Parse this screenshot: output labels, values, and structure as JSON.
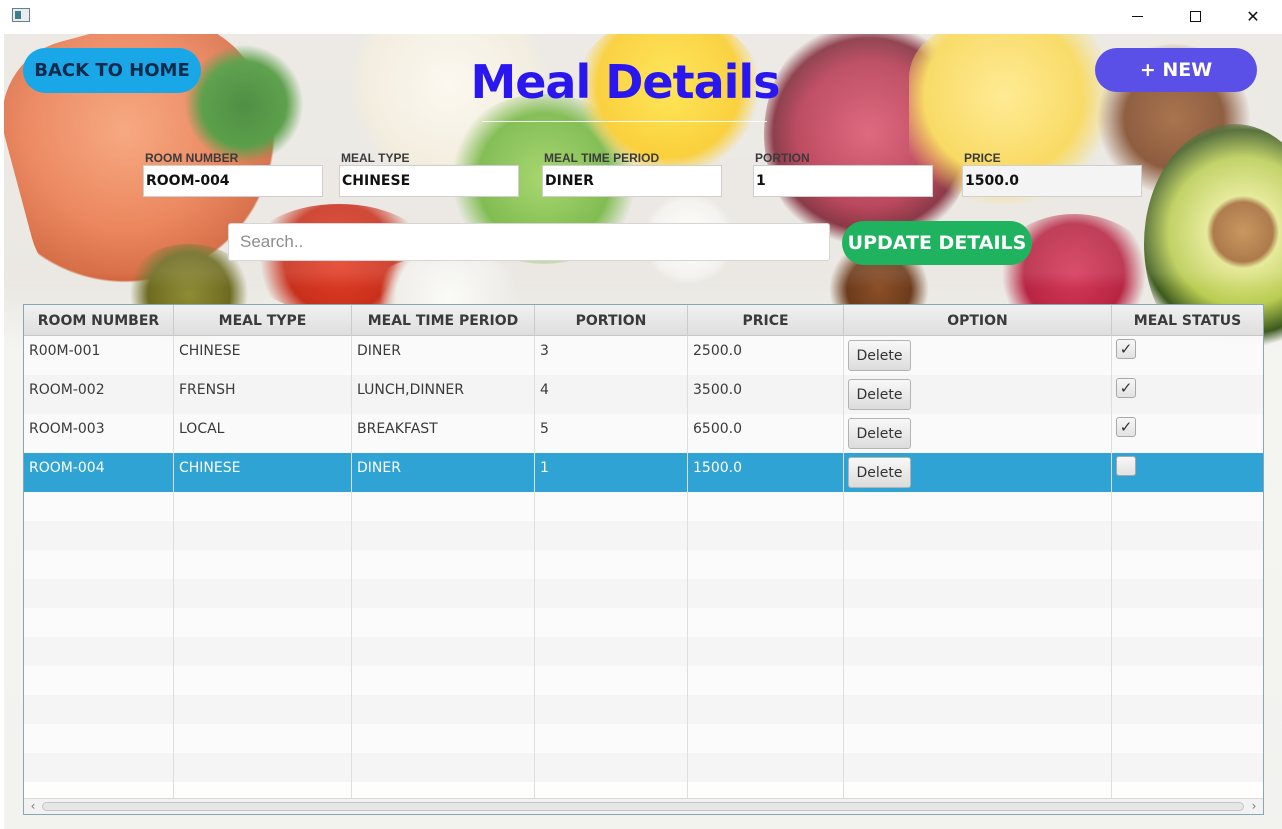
{
  "window": {
    "minimize_label": "",
    "maximize_label": "",
    "close_label": "✕"
  },
  "header": {
    "back_label": "BACK TO HOME",
    "title": "Meal Details",
    "new_label": "+ NEW"
  },
  "form": {
    "room_number": {
      "label": "ROOM NUMBER",
      "value": "ROOM-004"
    },
    "meal_type": {
      "label": "MEAL TYPE",
      "value": "CHINESE"
    },
    "meal_time_period": {
      "label": "MEAL TIME PERIOD",
      "value": "DINER"
    },
    "portion": {
      "label": "PORTION",
      "value": "1"
    },
    "price": {
      "label": "PRICE",
      "value": "1500.0"
    }
  },
  "search": {
    "placeholder": "Search..",
    "value": ""
  },
  "update_label": "UPDATE DETAILS",
  "table": {
    "columns": [
      "ROOM NUMBER",
      "MEAL TYPE",
      "MEAL TIME PERIOD",
      "PORTION",
      "PRICE",
      "OPTION",
      "MEAL STATUS"
    ],
    "rows": [
      {
        "room": "R00M-001",
        "type": "CHINESE",
        "period": "DINER",
        "portion": "3",
        "price": "2500.0",
        "option": "Delete",
        "status": "✓"
      },
      {
        "room": "ROOM-002",
        "type": "FRENSH",
        "period": "LUNCH,DINNER",
        "portion": "4",
        "price": "3500.0",
        "option": "Delete",
        "status": "✓"
      },
      {
        "room": "ROOM-003",
        "type": "LOCAL",
        "period": "BREAKFAST",
        "portion": "5",
        "price": "6500.0",
        "option": "Delete",
        "status": "✓"
      },
      {
        "room": "ROOM-004",
        "type": "CHINESE",
        "period": "DINER",
        "portion": "1",
        "price": "1500.0",
        "option": "Delete",
        "status": ""
      }
    ],
    "selected_row": 3
  },
  "colors": {
    "home_button": "#1aa7e8",
    "new_button": "#5a4fe6",
    "update_button": "#1fb35f",
    "title": "#2a17f0",
    "selected_row": "#2fa3d3"
  },
  "icons": {
    "app": "app-window-icon",
    "minimize": "minimize-icon",
    "maximize": "maximize-icon",
    "close": "close-icon",
    "scroll_left": "chevron-left-icon",
    "scroll_right": "chevron-right-icon"
  }
}
